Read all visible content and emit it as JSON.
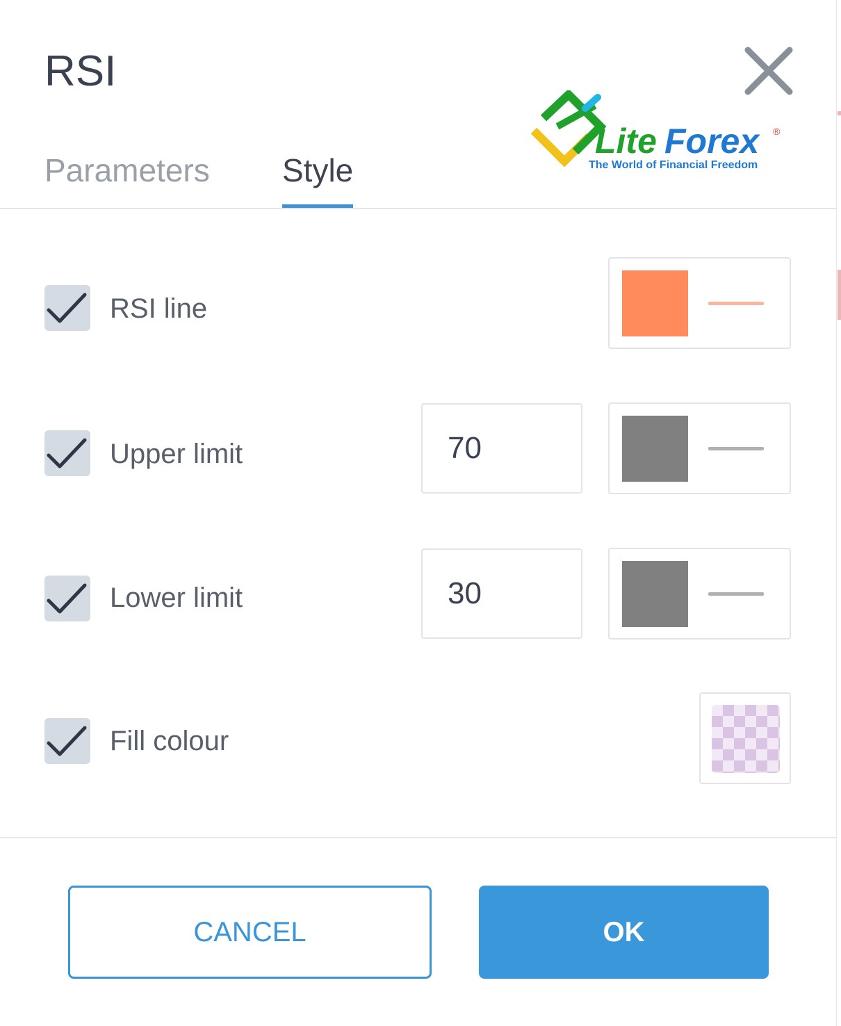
{
  "dialog": {
    "title": "RSI",
    "close_icon": "close-icon"
  },
  "logo": {
    "brand_lite": "Lite",
    "brand_forex": "Forex",
    "registered": "®",
    "tagline": "The World of Financial Freedom"
  },
  "tabs": [
    {
      "label": "Parameters",
      "active": false
    },
    {
      "label": "Style",
      "active": true
    }
  ],
  "rows": [
    {
      "label": "RSI line",
      "checked": true,
      "swatch_color": "#ff8a5c",
      "line_color": "#f8b79d"
    },
    {
      "label": "Upper limit",
      "checked": true,
      "value": "70",
      "swatch_color": "#808080",
      "line_color": "#b0b0b0"
    },
    {
      "label": "Lower limit",
      "checked": true,
      "value": "30",
      "swatch_color": "#808080",
      "line_color": "#b0b0b0"
    },
    {
      "label": "Fill colour",
      "checked": true,
      "fill_pattern": "transparent-checker"
    }
  ],
  "buttons": {
    "cancel_label": "CANCEL",
    "ok_label": "OK"
  },
  "colors": {
    "accent": "#3a95d8",
    "checkbox_bg": "#d5dbe3",
    "logo_green": "#1fa12b",
    "logo_yellow": "#f2c21a",
    "logo_blue": "#1f78d1",
    "logo_cyan": "#1fb6e8"
  }
}
